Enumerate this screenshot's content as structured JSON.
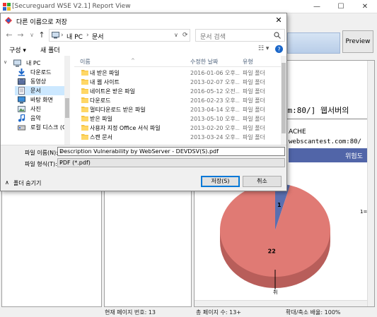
{
  "app": {
    "title": "[Secureguard WSE V2.1] Report View",
    "preview_label": "Preview",
    "window_controls": {
      "minimize": "—",
      "maximize": "☐",
      "close": "✕"
    }
  },
  "report": {
    "url_line": "t.com:80/] 웹서버의 ",
    "cache_text": "ACHE",
    "url2": "webscantest.com:80/",
    "header_cell": "위험도",
    "chart_side_label": "1=",
    "chart_bottom_label": "취"
  },
  "statusbar": {
    "current_page": "현재 페이지 번호: 13",
    "total_pages": "총 페이지 수: 13+",
    "zoom": "확대/축소 배율: 100%"
  },
  "dialog": {
    "title": "다른 이름으로 저장",
    "close": "✕",
    "nav": {
      "back": "←",
      "forward": "→",
      "recent": "∨",
      "up": "↑"
    },
    "breadcrumb": [
      "내 PC",
      "문서"
    ],
    "breadcrumb_sep": "›",
    "search_placeholder": "문서 검색",
    "toolbar": {
      "organize": "구성 ▾",
      "new_folder": "새 폴더"
    },
    "nav_tree": [
      {
        "label": "내 PC",
        "icon": "pc-icon"
      },
      {
        "label": "다운로드",
        "icon": "download-icon"
      },
      {
        "label": "동영상",
        "icon": "video-icon"
      },
      {
        "label": "문서",
        "icon": "document-icon",
        "selected": true
      },
      {
        "label": "바탕 화면",
        "icon": "desktop-icon"
      },
      {
        "label": "사진",
        "icon": "picture-icon"
      },
      {
        "label": "음악",
        "icon": "music-icon"
      },
      {
        "label": "로컬 디스크 (C:)",
        "icon": "disk-icon"
      }
    ],
    "columns": {
      "name": "이름",
      "date": "수정한 날짜",
      "type": "유형"
    },
    "files": [
      {
        "name": "내 받은 파일",
        "date": "2016-01-06 오후...",
        "type": "파일 폴더"
      },
      {
        "name": "내 웹 사이트",
        "date": "2013-02-07 오후...",
        "type": "파일 폴더"
      },
      {
        "name": "네이트온 받은 파일",
        "date": "2016-05-12 오전...",
        "type": "파일 폴더"
      },
      {
        "name": "다운로드",
        "date": "2016-02-23 오후...",
        "type": "파일 폴더"
      },
      {
        "name": "멀티다운로드 받은 파일",
        "date": "2013-04-14 오후...",
        "type": "파일 폴더"
      },
      {
        "name": "받은 파일",
        "date": "2013-05-10 오후...",
        "type": "파일 폴더"
      },
      {
        "name": "사용자 지정 Office 서식 파일",
        "date": "2013-02-20 오후...",
        "type": "파일 폴더"
      },
      {
        "name": "스캔 문서",
        "date": "2013-03-24 오후...",
        "type": "파일 폴더"
      }
    ],
    "filename_label": "파일 이름(N):",
    "filename_value": "Description Vulnerability by WebServer - DEVDSV(S).pdf",
    "filetype_label": "파일 형식(T):",
    "filetype_value": "PDF (*.pdf)",
    "hide_folders": "폴더 숨기기",
    "save_button": "저장(S)",
    "cancel_button": "취소"
  },
  "chart_data": {
    "type": "pie",
    "categories": [
      "",
      ""
    ],
    "values": [
      1,
      22
    ],
    "colors": [
      "#5a6fb0",
      "#e07a74"
    ],
    "data_labels": [
      "1",
      "22"
    ]
  }
}
